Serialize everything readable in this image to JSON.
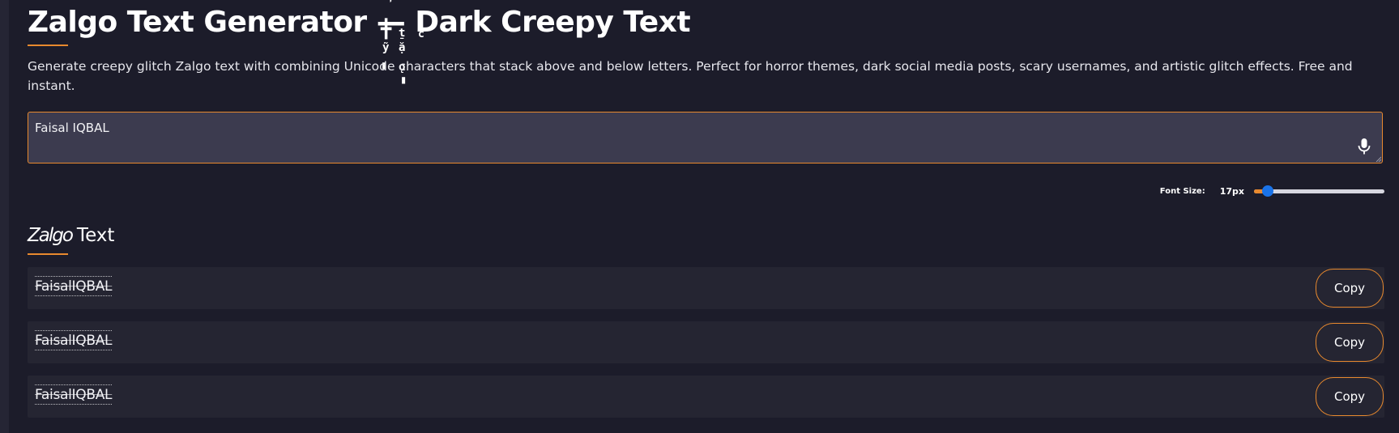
{
  "header": {
    "title": "Zalgo Text Generator — Dark Creepy Text",
    "description": "Generate creepy glitch Zalgo text with combining Unicode characters that stack above and below letters. Perfect for horror themes, dark social media posts, scary usernames, and artistic glitch effects. Free and instant."
  },
  "input": {
    "value": "Faisal IQBAL",
    "mic_icon": "microphone-icon"
  },
  "font_size": {
    "label": "Font Size:",
    "value_text": "17px",
    "slider_fraction": 0.07
  },
  "section": {
    "heading_zalgo": "Zalgo",
    "heading_rest": "Text"
  },
  "results": [
    {
      "text": "FaisalIQBAL",
      "copy_label": "Copy"
    },
    {
      "text": "FaisalIQBAL",
      "copy_label": "Copy"
    },
    {
      "text": "FaisalIQBAL",
      "copy_label": "Copy"
    }
  ],
  "colors": {
    "background": "#1c1c2a",
    "accent": "#e8892e",
    "input_bg": "#3c3b4f",
    "row_bg": "#252532",
    "slider_thumb": "#1a73e8"
  }
}
